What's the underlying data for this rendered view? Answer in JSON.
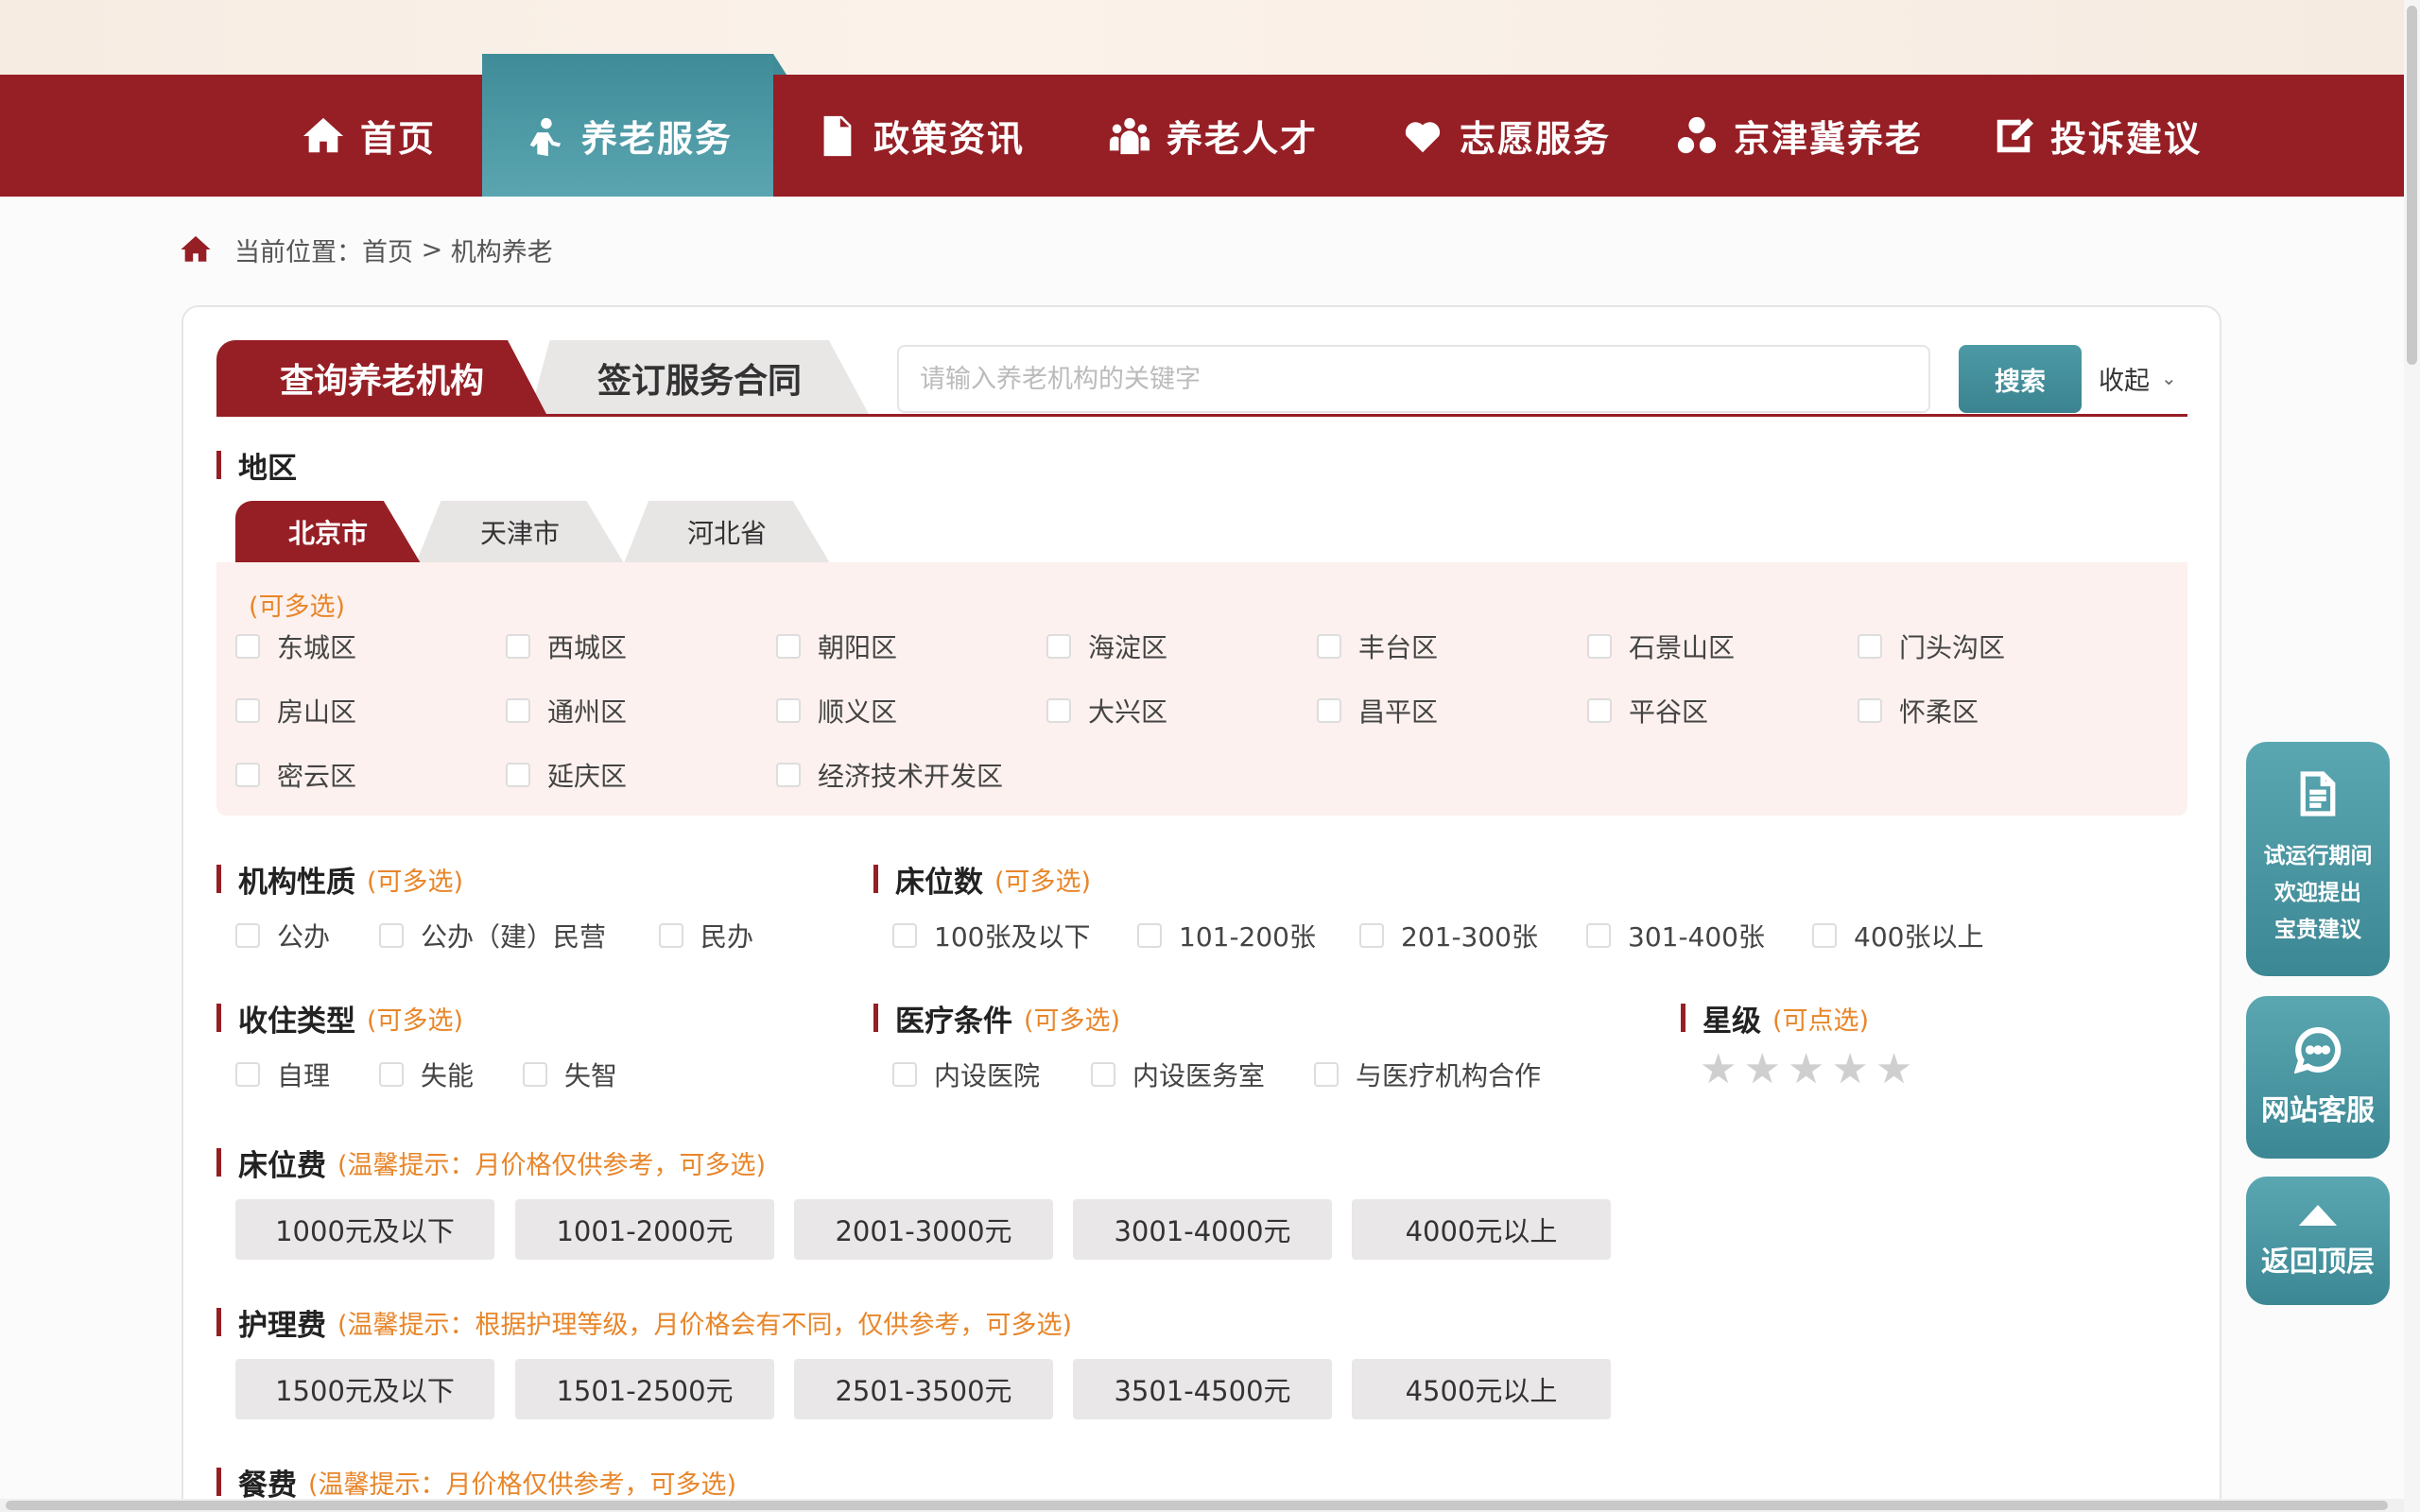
{
  "nav": {
    "items": [
      {
        "label": "首页",
        "icon": "home-icon"
      },
      {
        "label": "养老服务",
        "icon": "elder-person-icon"
      },
      {
        "label": "政策资讯",
        "icon": "document-icon"
      },
      {
        "label": "养老人才",
        "icon": "people-group-icon"
      },
      {
        "label": "志愿服务",
        "icon": "heart-hand-icon"
      },
      {
        "label": "京津冀养老",
        "icon": "triad-icon"
      },
      {
        "label": "投诉建议",
        "icon": "edit-icon"
      }
    ],
    "active_index": 1,
    "bg_color": "#961e25",
    "active_color": "#4c9aa6"
  },
  "breadcrumb": {
    "label": "当前位置：",
    "home": "首页",
    "sep": " > ",
    "current": "机构养老"
  },
  "tabs": {
    "query": "查询养老机构",
    "contract": "签订服务合同"
  },
  "search": {
    "placeholder": "请输入养老机构的关键字",
    "button": "搜索",
    "collapse": "收起"
  },
  "region": {
    "title": "地区",
    "tabs": [
      "北京市",
      "天津市",
      "河北省"
    ],
    "multi_hint": "(可多选)",
    "districts": [
      "东城区",
      "西城区",
      "朝阳区",
      "海淀区",
      "丰台区",
      "石景山区",
      "门头沟区",
      "房山区",
      "通州区",
      "顺义区",
      "大兴区",
      "昌平区",
      "平谷区",
      "怀柔区",
      "密云区",
      "延庆区",
      "经济技术开发区"
    ]
  },
  "nature": {
    "title": "机构性质",
    "hint": "(可多选)",
    "options": [
      "公办",
      "公办（建）民营",
      "民办"
    ]
  },
  "beds": {
    "title": "床位数",
    "hint": "(可多选)",
    "options": [
      "100张及以下",
      "101-200张",
      "201-300张",
      "301-400张",
      "400张以上"
    ]
  },
  "residence": {
    "title": "收住类型",
    "hint": "(可多选)",
    "options": [
      "自理",
      "失能",
      "失智"
    ]
  },
  "medical": {
    "title": "医疗条件",
    "hint": "(可多选)",
    "options": [
      "内设医院",
      "内设医务室",
      "与医疗机构合作"
    ]
  },
  "rating": {
    "title": "星级",
    "hint": "(可点选)",
    "stars": 5,
    "selected": 0
  },
  "bed_fee": {
    "title": "床位费",
    "hint": "(温馨提示：月价格仅供参考，可多选)",
    "options": [
      "1000元及以下",
      "1001-2000元",
      "2001-3000元",
      "3001-4000元",
      "4000元以上"
    ]
  },
  "care_fee": {
    "title": "护理费",
    "hint": "(温馨提示：根据护理等级，月价格会有不同，仅供参考，可多选)",
    "options": [
      "1500元及以下",
      "1501-2500元",
      "2501-3500元",
      "3501-4500元",
      "4500元以上"
    ]
  },
  "meal_fee": {
    "title": "餐费",
    "hint": "(温馨提示：月价格仅供参考，可多选)"
  },
  "float": {
    "feedback": [
      "试运行期间",
      "欢迎提出",
      "宝贵建议"
    ],
    "service": "网站客服",
    "top": "返回顶层"
  }
}
